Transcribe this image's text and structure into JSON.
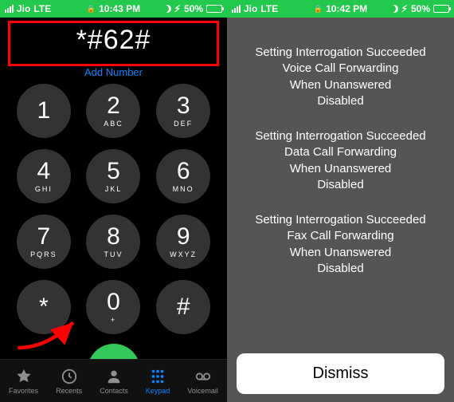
{
  "left": {
    "status": {
      "carrier": "Jio",
      "network": "LTE",
      "time": "10:43 PM",
      "battery_pct": "50%"
    },
    "dial": {
      "entered": "*#62#",
      "add_number": "Add Number"
    },
    "keys": [
      {
        "digit": "1",
        "letters": ""
      },
      {
        "digit": "2",
        "letters": "ABC"
      },
      {
        "digit": "3",
        "letters": "DEF"
      },
      {
        "digit": "4",
        "letters": "GHI"
      },
      {
        "digit": "5",
        "letters": "JKL"
      },
      {
        "digit": "6",
        "letters": "MNO"
      },
      {
        "digit": "7",
        "letters": "PQRS"
      },
      {
        "digit": "8",
        "letters": "TUV"
      },
      {
        "digit": "9",
        "letters": "WXYZ"
      },
      {
        "digit": "*",
        "letters": ""
      },
      {
        "digit": "0",
        "letters": "+"
      },
      {
        "digit": "#",
        "letters": ""
      }
    ],
    "tabs": {
      "favorites": "Favorites",
      "recents": "Recents",
      "contacts": "Contacts",
      "keypad": "Keypad",
      "voicemail": "Voicemail"
    }
  },
  "right": {
    "status": {
      "carrier": "Jio",
      "network": "LTE",
      "time": "10:42 PM",
      "battery_pct": "50%"
    },
    "groups": [
      [
        "Setting Interrogation Succeeded",
        "Voice Call Forwarding",
        "When Unanswered",
        "Disabled"
      ],
      [
        "Setting Interrogation Succeeded",
        "Data Call Forwarding",
        "When Unanswered",
        "Disabled"
      ],
      [
        "Setting Interrogation Succeeded",
        "Fax Call Forwarding",
        "When Unanswered",
        "Disabled"
      ]
    ],
    "dismiss": "Dismiss"
  }
}
